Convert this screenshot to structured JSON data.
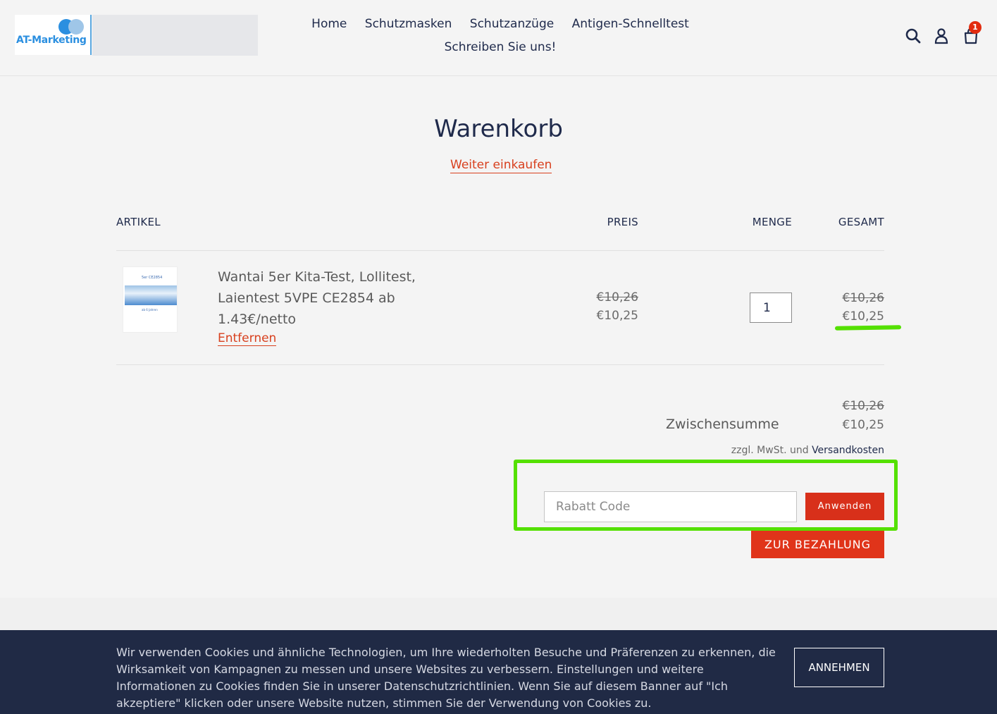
{
  "header": {
    "logo_text": "AT-Marketing",
    "nav": [
      "Home",
      "Schutzmasken",
      "Schutzanzüge",
      "Antigen-Schnelltest",
      "Schreiben Sie uns!"
    ],
    "cart_count": "1"
  },
  "cart": {
    "title": "Warenkorb",
    "continue_label": "Weiter einkaufen",
    "columns": {
      "item": "ARTIKEL",
      "price": "PREIS",
      "qty": "MENGE",
      "total": "GESAMT"
    },
    "item": {
      "thumb_title": "5er CE2854",
      "thumb_subtitle": "ab 6 Jahren",
      "name": "Wantai 5er Kita-Test, Lollitest, Laientest 5VPE CE2854 ab 1.43€/netto",
      "remove_label": "Entfernen",
      "price_old": "€10,26",
      "price_new": "€10,25",
      "quantity": "1",
      "total_old": "€10,26",
      "total_new": "€10,25"
    },
    "subtotal": {
      "label": "Zwischensumme",
      "old": "€10,26",
      "new": "€10,25",
      "tax_note": "zzgl. MwSt. und ",
      "shipping_link": "Versandkosten"
    },
    "coupon": {
      "placeholder": "Rabatt Code",
      "apply_label": "Anwenden"
    },
    "checkout_label": "ZUR BEZAHLUNG"
  },
  "cookie": {
    "text": "Wir verwenden Cookies und ähnliche Technologien, um Ihre wiederholten Besuche und Präferenzen zu erkennen, die Wirksamkeit von Kampagnen zu messen und unsere Websites zu verbessern. Einstellungen und weitere Informationen zu Cookies finden Sie in unserer Datenschutzrichtlinien. Wenn Sie auf diesem Banner auf \"Ich akzeptiere\" klicken oder unsere Website nutzen, stimmen Sie der Verwendung von Cookies zu.",
    "accept_label": "ANNEHMEN"
  },
  "colors": {
    "accent": "#e0341a",
    "highlight": "#54e000",
    "navy": "#202a45"
  }
}
